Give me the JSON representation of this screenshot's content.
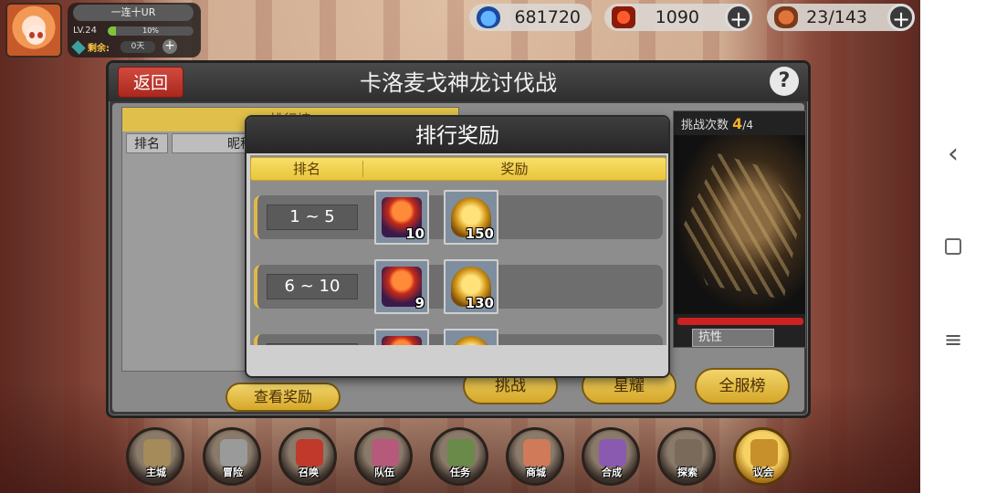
{
  "player": {
    "name": "一连十UR",
    "level": "LV.24",
    "exp_percent_text": "10%",
    "exp_fraction": 0.1,
    "remain_label": "剩余:",
    "remain_value": "0天",
    "plus": "+"
  },
  "resources": {
    "gems": "681720",
    "stamina": "1090",
    "food": "23/143",
    "plus": "+"
  },
  "main": {
    "back_label": "返回",
    "title": "卡洛麦戈神龙讨伐战",
    "help": "?",
    "rank_panel_title": "排行榜",
    "rank_col_rank": "排名",
    "rank_col_name": "昵称",
    "view_reward_label": "查看奖励",
    "challenge_label": "挑战次数",
    "challenge_current": "4",
    "challenge_max": "/4",
    "resist_label": "抗性",
    "btn_challenge": "挑战",
    "btn_star": "星耀",
    "btn_server": "全服榜"
  },
  "modal": {
    "title": "排行奖励",
    "col_rank": "排名",
    "col_reward": "奖励",
    "rows": [
      {
        "range": "1 ~ 5",
        "items": [
          {
            "icon": "stamina-box-icon",
            "count": "10"
          },
          {
            "icon": "golden-helmet-icon",
            "count": "150"
          }
        ]
      },
      {
        "range": "6 ~ 10",
        "items": [
          {
            "icon": "stamina-box-icon",
            "count": "9"
          },
          {
            "icon": "golden-helmet-icon",
            "count": "130"
          }
        ]
      }
    ]
  },
  "bottom_nav": [
    {
      "label": "主城",
      "icon": "castle-icon",
      "active": false
    },
    {
      "label": "冒险",
      "icon": "crossed-swords-icon",
      "active": false
    },
    {
      "label": "召唤",
      "icon": "summon-card-icon",
      "active": false
    },
    {
      "label": "队伍",
      "icon": "team-emblem-icon",
      "active": false
    },
    {
      "label": "任务",
      "icon": "quest-book-icon",
      "active": false
    },
    {
      "label": "商城",
      "icon": "shop-icon",
      "active": false
    },
    {
      "label": "合成",
      "icon": "potion-icon",
      "active": false
    },
    {
      "label": "探索",
      "icon": "explore-bow-icon",
      "active": false
    },
    {
      "label": "议会",
      "icon": "council-crest-icon",
      "active": true
    }
  ],
  "colors": {
    "accent_gold": "#e9c53a",
    "back_red": "#c23a2e",
    "hp_red": "#cc2222"
  }
}
